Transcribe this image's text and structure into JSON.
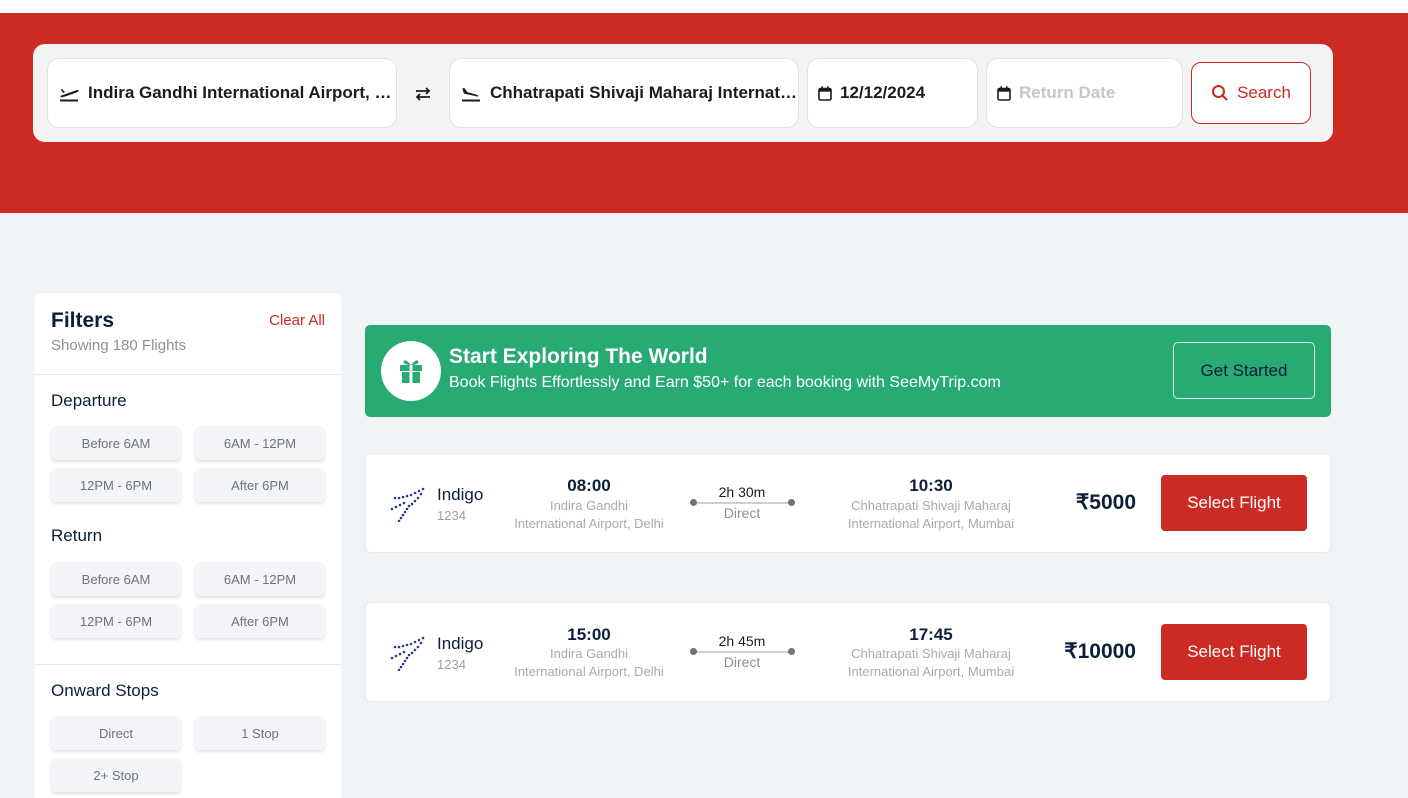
{
  "search": {
    "from": "Indira Gandhi International Airport, Delhi",
    "to": "Chhatrapati Shivaji Maharaj International Airport, Mumbai",
    "depart_date": "12/12/2024",
    "return_placeholder": "Return Date",
    "search_label": "Search"
  },
  "filters": {
    "title": "Filters",
    "clear_label": "Clear All",
    "showing": "Showing 180 Flights",
    "departure_title": "Departure",
    "departure_options": [
      "Before 6AM",
      "6AM - 12PM",
      "12PM - 6PM",
      "After 6PM"
    ],
    "return_title": "Return",
    "return_options": [
      "Before 6AM",
      "6AM - 12PM",
      "12PM - 6PM",
      "After 6PM"
    ],
    "stops_title": "Onward Stops",
    "stops_options": [
      "Direct",
      "1 Stop",
      "2+ Stop"
    ]
  },
  "promo": {
    "title": "Start Exploring The World",
    "subtitle": "Book Flights Effortlessly and Earn $50+ for each booking with SeeMyTrip.com",
    "button": "Get Started"
  },
  "flights": [
    {
      "airline": "Indigo",
      "number": "1234",
      "dep_time": "08:00",
      "dep_airport_line1": "Indira Gandhi",
      "dep_airport_line2": "International Airport, Delhi",
      "duration": "2h 30m",
      "stops": "Direct",
      "arr_time": "10:30",
      "arr_airport_line1": "Chhatrapati Shivaji Maharaj",
      "arr_airport_line2": "International Airport, Mumbai",
      "price": "₹5000",
      "button": "Select Flight"
    },
    {
      "airline": "Indigo",
      "number": "1234",
      "dep_time": "15:00",
      "dep_airport_line1": "Indira Gandhi",
      "dep_airport_line2": "International Airport, Delhi",
      "duration": "2h 45m",
      "stops": "Direct",
      "arr_time": "17:45",
      "arr_airport_line1": "Chhatrapati Shivaji Maharaj",
      "arr_airport_line2": "International Airport, Mumbai",
      "price": "₹10000",
      "button": "Select Flight"
    }
  ],
  "colors": {
    "brand_red": "#cc2b24",
    "promo_green": "#27ab72",
    "navy": "#0b1f3a"
  }
}
